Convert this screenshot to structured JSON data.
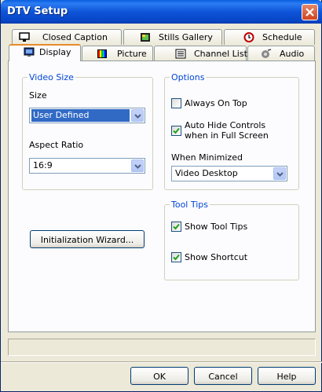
{
  "window": {
    "title": "DTV Setup"
  },
  "tabs": {
    "row_back": [
      {
        "label": "Closed Caption",
        "icon": "closed-caption-icon"
      },
      {
        "label": "Stills Gallery",
        "icon": "stills-gallery-icon"
      },
      {
        "label": "Schedule",
        "icon": "schedule-icon"
      }
    ],
    "row_front": [
      {
        "label": "Display",
        "icon": "display-icon",
        "active": true
      },
      {
        "label": "Picture",
        "icon": "picture-icon"
      },
      {
        "label": "Channel List",
        "icon": "channel-list-icon"
      },
      {
        "label": "Audio",
        "icon": "audio-icon"
      }
    ]
  },
  "video_size": {
    "legend": "Video Size",
    "size_label": "Size",
    "size_value": "User Defined",
    "aspect_label": "Aspect Ratio",
    "aspect_value": "16:9"
  },
  "options": {
    "legend": "Options",
    "always_on_top": {
      "label": "Always On Top",
      "checked": false
    },
    "auto_hide": {
      "line1": "Auto Hide Controls",
      "line2": "when in Full Screen",
      "checked": true
    },
    "minimized_label": "When Minimized",
    "minimized_value": "Video Desktop"
  },
  "tool_tips": {
    "legend": "Tool Tips",
    "show_tool_tips": {
      "label": "Show Tool Tips",
      "checked": true
    },
    "show_shortcut": {
      "label": "Show Shortcut",
      "checked": true
    }
  },
  "wizard_button": "Initialization Wizard...",
  "footer": {
    "ok": "OK",
    "cancel": "Cancel",
    "help": "Help"
  },
  "colors": {
    "accent": "#0046d5",
    "titlebar": "#0a5fe0",
    "selection": "#316ac5",
    "active_tab": "#e68b2c"
  }
}
